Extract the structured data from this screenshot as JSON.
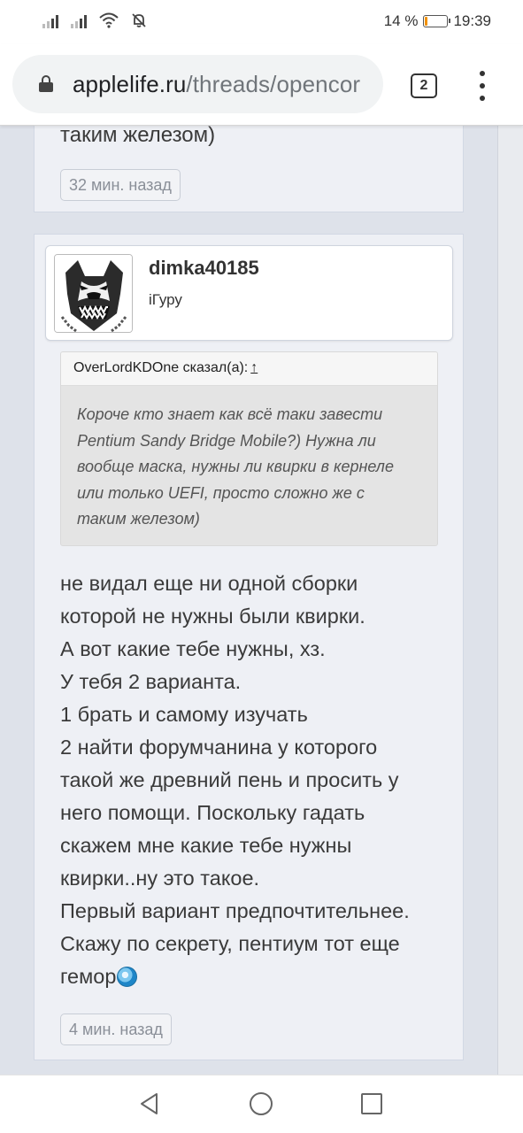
{
  "status_bar": {
    "battery_text": "14 %",
    "battery_level": 0.14,
    "battery_color": "#f29100",
    "time": "19:39",
    "icons": [
      "signal-icon",
      "signal-icon",
      "wifi-icon",
      "mute-icon",
      "battery-icon"
    ]
  },
  "browser": {
    "url_host": "applelife.ru",
    "url_path": "/threads/opencor",
    "tab_count": "2",
    "icons": [
      "lock-icon",
      "overflow-menu-icon"
    ]
  },
  "previous_post": {
    "text_tail": "таким железом)",
    "time": "32 мин. назад"
  },
  "post": {
    "author": "dimka40185",
    "author_title": "iГуру",
    "avatar_icon": "pitbull-avatar-icon",
    "quote": {
      "header": "OverLordKDOne сказал(а):",
      "arrow": "↑",
      "lines": [
        "Короче кто знает как всё таки завести",
        "Pentium Sandy Bridge Mobile?) Нужна ли",
        "вообще маска, нужны ли квирки в кернеле",
        "или только UEFI, просто сложно же с",
        "таким железом)"
      ]
    },
    "message_lines": [
      "не видал еще ни одной сборки",
      "которой не нужны были квирки.",
      "А вот какие тебе нужны, хз.",
      "У тебя 2 варианта.",
      "1 брать и самому изучать",
      "2 найти форумчанина у которого",
      "такой же древний пень и просить у",
      "него помощи. Поскольку гадать",
      "скажем мне какие тебе нужны",
      "квирки..ну это такое.",
      "Первый вариант предпочтительнее.",
      "Скажу по секрету, пентиум тот еще",
      "гемор"
    ],
    "emoji_icon": "smiley-emoji-icon",
    "time": "4 мин. назад"
  },
  "nav": {
    "icons": [
      "back-icon",
      "home-icon",
      "recents-icon"
    ]
  },
  "colors": {
    "page_bg": "#dee2ea",
    "post_bg": "#eef0f5",
    "quote_bg": "#e4e4e4",
    "text": "#3a3a3a"
  }
}
